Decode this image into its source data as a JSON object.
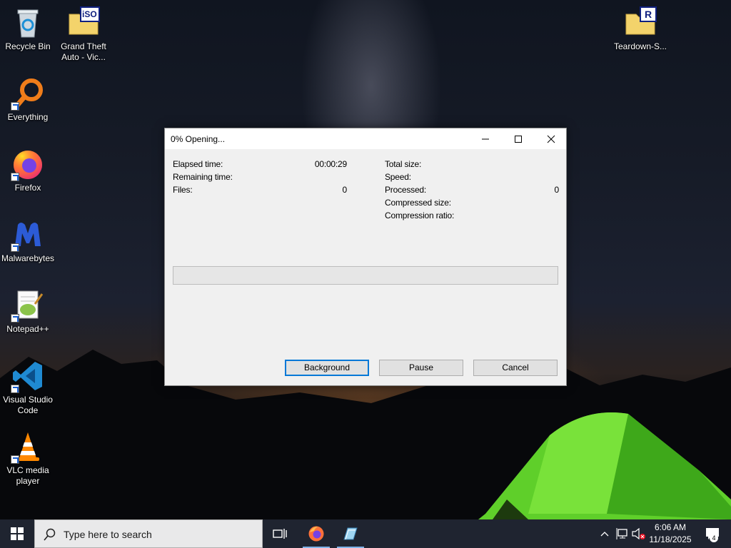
{
  "desktop": {
    "icons": [
      {
        "label": "Recycle Bin"
      },
      {
        "label": "Grand Theft Auto - Vic..."
      },
      {
        "label": "Everything"
      },
      {
        "label": "Firefox"
      },
      {
        "label": "Malwarebytes"
      },
      {
        "label": "Notepad++"
      },
      {
        "label": "Visual Studio Code"
      },
      {
        "label": "VLC media player"
      },
      {
        "label": "Teardown-S..."
      }
    ],
    "iso_badge": "iSO",
    "r_badge": "R"
  },
  "dialog": {
    "title": "0% Opening...",
    "progress_percent": 0,
    "left": {
      "elapsed_label": "Elapsed time:",
      "elapsed_value": "00:00:29",
      "remaining_label": "Remaining time:",
      "remaining_value": "",
      "files_label": "Files:",
      "files_value": "0"
    },
    "right": {
      "total_size_label": "Total size:",
      "total_size_value": "",
      "speed_label": "Speed:",
      "speed_value": "",
      "processed_label": "Processed:",
      "processed_value": "0",
      "compressed_size_label": "Compressed size:",
      "compressed_size_value": "",
      "ratio_label": "Compression ratio:",
      "ratio_value": ""
    },
    "buttons": {
      "background": "Background",
      "pause": "Pause",
      "cancel": "Cancel"
    }
  },
  "taskbar": {
    "search_placeholder": "Type here to search",
    "time": "6:06 AM",
    "date": "11/18/2025",
    "notification_count": "4"
  },
  "colors": {
    "accent": "#0078d7",
    "taskbar": "#1f2430",
    "dialog_bg": "#f0f0f0"
  }
}
